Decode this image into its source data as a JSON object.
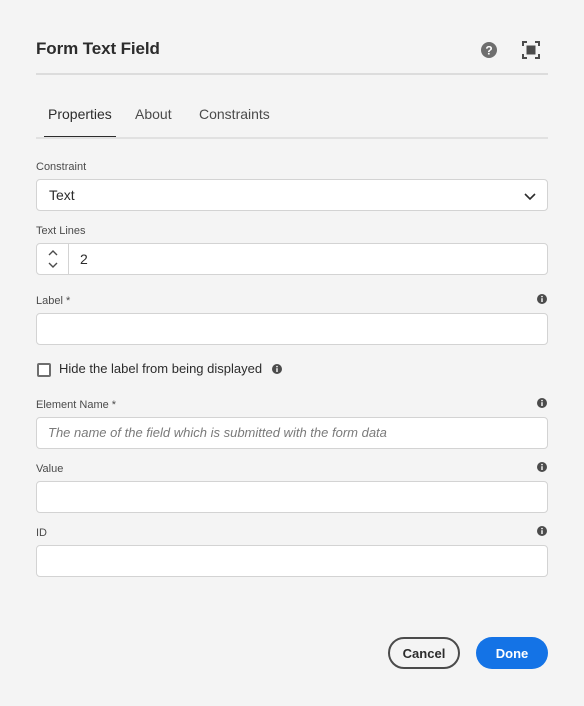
{
  "dialog": {
    "title": "Form Text Field",
    "icons": {
      "help": "help-circle-icon",
      "fullscreen": "fullscreen-icon"
    }
  },
  "tabs": [
    {
      "label": "Properties",
      "selected": true
    },
    {
      "label": "About",
      "selected": false
    },
    {
      "label": "Constraints",
      "selected": false
    }
  ],
  "fields": {
    "constraint": {
      "label": "Constraint",
      "value": "Text"
    },
    "text_lines": {
      "label": "Text Lines",
      "value": "2"
    },
    "label": {
      "label": "Label *",
      "value": ""
    },
    "hide_label": {
      "label": "Hide the label from being displayed",
      "checked": false
    },
    "element_name": {
      "label": "Element Name *",
      "value": "",
      "placeholder": "The name of the field which is submitted with the form data"
    },
    "value": {
      "label": "Value",
      "value": ""
    },
    "id": {
      "label": "ID",
      "value": ""
    }
  },
  "buttons": {
    "cancel": "Cancel",
    "done": "Done"
  },
  "colors": {
    "accent": "#1473e6",
    "background": "#f4f4f4",
    "text": "#2c2c2c"
  }
}
